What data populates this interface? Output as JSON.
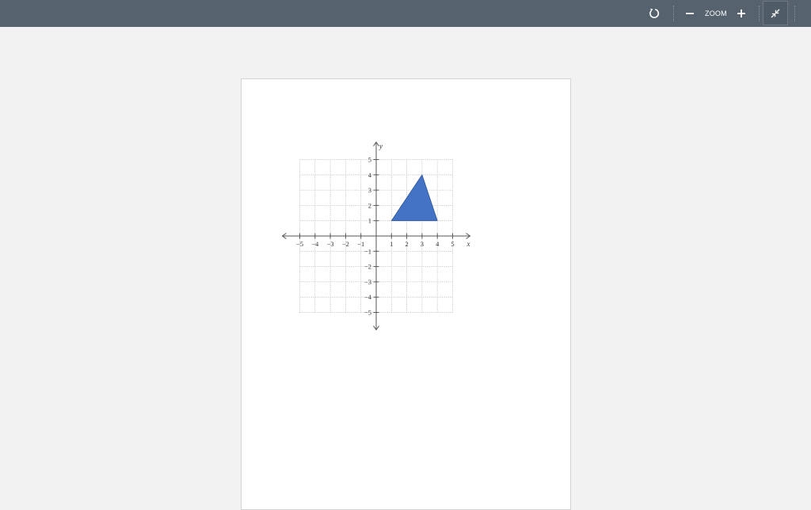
{
  "toolbar": {
    "refresh_icon": "rotate-icon",
    "zoom_out_icon": "minus-icon",
    "zoom_label": "ZOOM",
    "zoom_in_icon": "plus-icon",
    "collapse_icon": "collapse-arrows-icon"
  },
  "colors": {
    "toolbar_bg": "#56626e",
    "workspace_bg": "#f2f2f2",
    "page_bg": "#ffffff",
    "shape_fill": "#4472c4",
    "shape_stroke": "#2f5597"
  },
  "chart_data": {
    "type": "scatter",
    "xlabel": "x",
    "ylabel": "y",
    "xlim": [
      -5,
      5
    ],
    "ylim": [
      -5,
      5
    ],
    "grid": true,
    "x_ticks": [
      "−5",
      "−4",
      "−3",
      "−2",
      "−1",
      "1",
      "2",
      "3",
      "4",
      "5"
    ],
    "y_ticks": [
      "5",
      "4",
      "3",
      "2",
      "1",
      "−1",
      "−2",
      "−3",
      "−4",
      "−5"
    ],
    "polygon": {
      "name": "",
      "points": [
        [
          1,
          1
        ],
        [
          3,
          4
        ],
        [
          4,
          1
        ]
      ]
    }
  }
}
